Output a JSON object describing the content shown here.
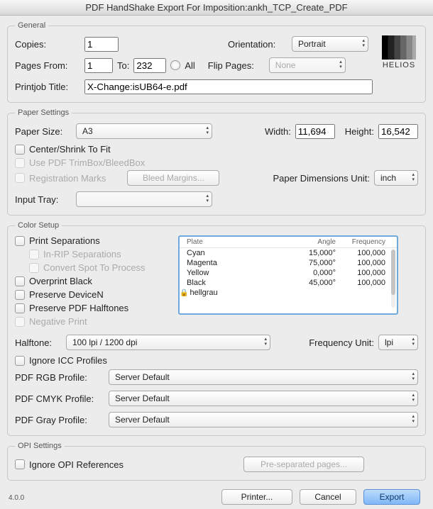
{
  "title": "PDF HandShake Export For Imposition:ankh_TCP_Create_PDF",
  "logo": "HELIOS",
  "version": "4.0.0",
  "general": {
    "legend": "General",
    "copies_label": "Copies:",
    "copies": "1",
    "orientation_label": "Orientation:",
    "orientation": "Portrait",
    "pages_from_label": "Pages From:",
    "pages_from": "1",
    "to_label": "To:",
    "pages_to": "232",
    "all_label": "All",
    "flip_label": "Flip Pages:",
    "flip": "None",
    "printjob_label": "Printjob Title:",
    "printjob": "X-Change:isUB64-e.pdf"
  },
  "paper": {
    "legend": "Paper Settings",
    "size_label": "Paper Size:",
    "size": "A3",
    "width_label": "Width:",
    "width": "11,694",
    "height_label": "Height:",
    "height": "16,542",
    "center_label": "Center/Shrink To Fit",
    "trimbox_label": "Use PDF TrimBox/BleedBox",
    "regmarks_label": "Registration Marks",
    "bleed_btn": "Bleed Margins...",
    "dimunit_label": "Paper Dimensions Unit:",
    "dimunit": "inch",
    "tray_label": "Input Tray:",
    "tray": ""
  },
  "color": {
    "legend": "Color Setup",
    "print_sep": "Print Separations",
    "in_rip": "In-RIP Separations",
    "convert_spot": "Convert Spot To Process",
    "overprint": "Overprint Black",
    "devicen": "Preserve DeviceN",
    "halftones": "Preserve PDF Halftones",
    "negative": "Negative Print",
    "plate_hdr": "Plate",
    "angle_hdr": "Angle",
    "freq_hdr": "Frequency",
    "plates": [
      {
        "name": "Cyan",
        "angle": "15,000°",
        "freq": "100,000"
      },
      {
        "name": "Magenta",
        "angle": "75,000°",
        "freq": "100,000"
      },
      {
        "name": "Yellow",
        "angle": "0,000°",
        "freq": "100,000"
      },
      {
        "name": "Black",
        "angle": "45,000°",
        "freq": "100,000"
      },
      {
        "name": "hellgrau",
        "angle": "",
        "freq": "",
        "locked": true
      }
    ],
    "halftone_label": "Halftone:",
    "halftone": "100 lpi / 1200 dpi",
    "frequnit_label": "Frequency Unit:",
    "frequnit": "lpi",
    "ignore_icc": "Ignore ICC Profiles",
    "rgb_label": "PDF RGB Profile:",
    "rgb": "Server Default",
    "cmyk_label": "PDF CMYK Profile:",
    "cmyk": "Server Default",
    "gray_label": "PDF Gray Profile:",
    "gray": "Server Default"
  },
  "opi": {
    "legend": "OPI Settings",
    "ignore": "Ignore OPI References",
    "presep_btn": "Pre-separated pages..."
  },
  "buttons": {
    "printer": "Printer...",
    "cancel": "Cancel",
    "export": "Export"
  }
}
